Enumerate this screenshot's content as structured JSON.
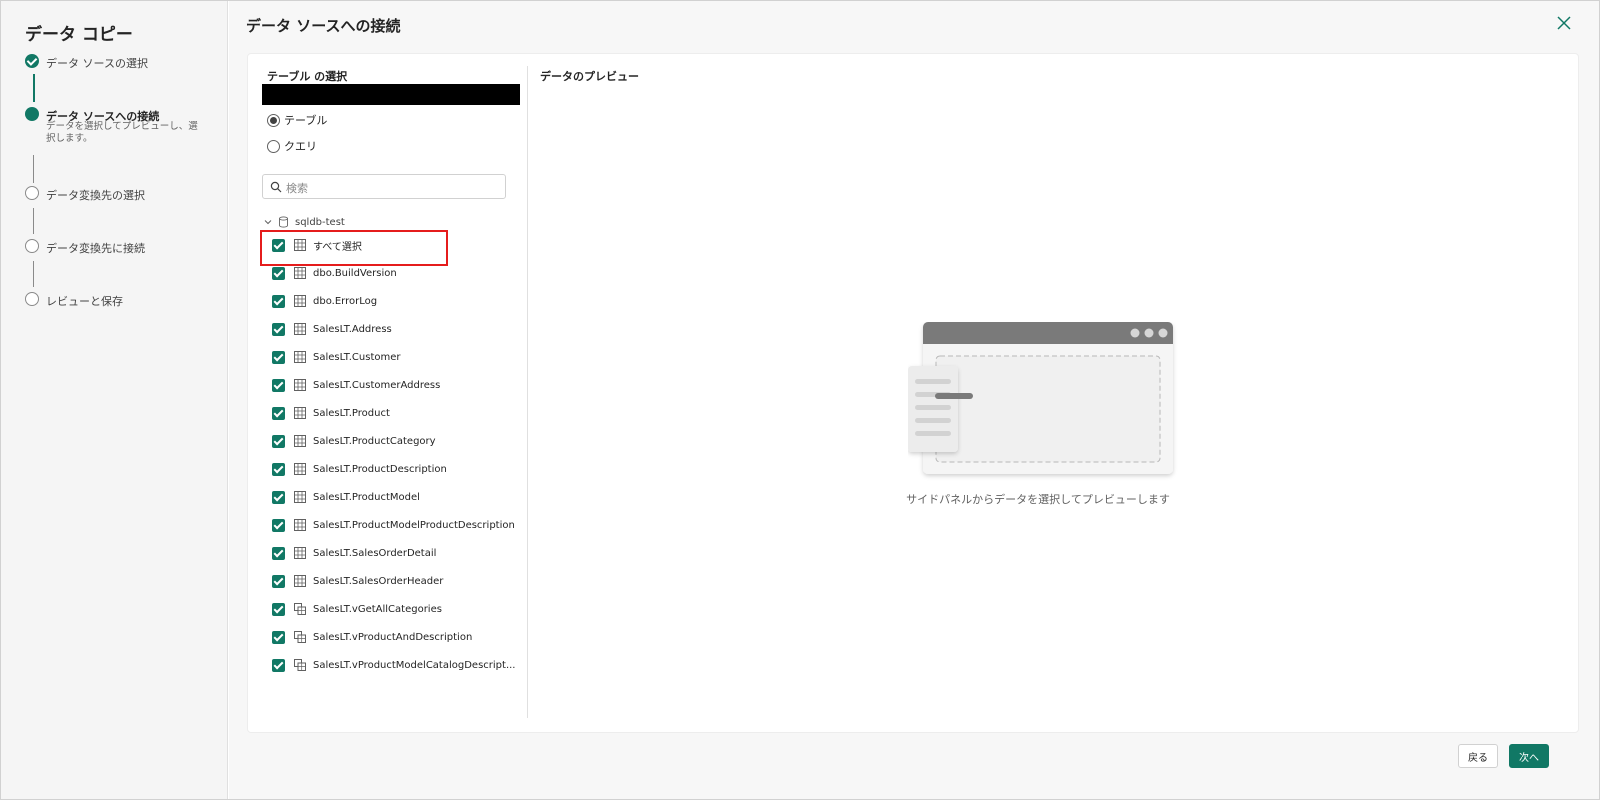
{
  "wizard": {
    "title": "データ コピー",
    "steps": [
      {
        "label": "データ ソースの選択",
        "status": "done"
      },
      {
        "label": "データ ソースへの接続",
        "status": "current",
        "description": "データを選択してプレビューし、選択します。"
      },
      {
        "label": "データ変換先の選択",
        "status": "todo"
      },
      {
        "label": "データ変換先に接続",
        "status": "todo"
      },
      {
        "label": "レビューと保存",
        "status": "todo"
      }
    ]
  },
  "main": {
    "title": "データ ソースへの接続",
    "left_pane": {
      "title": "テーブル の選択",
      "radio_options": [
        {
          "label": "テーブル",
          "selected": true
        },
        {
          "label": "クエリ",
          "selected": false
        }
      ],
      "search_placeholder": "検索",
      "tree_root": "sqldb-test",
      "items": [
        {
          "label": "すべて選択",
          "icon": "table-icon",
          "checked": true
        },
        {
          "label": "dbo.BuildVersion",
          "icon": "table-icon",
          "checked": true
        },
        {
          "label": "dbo.ErrorLog",
          "icon": "table-icon",
          "checked": true
        },
        {
          "label": "SalesLT.Address",
          "icon": "table-icon",
          "checked": true
        },
        {
          "label": "SalesLT.Customer",
          "icon": "table-icon",
          "checked": true
        },
        {
          "label": "SalesLT.CustomerAddress",
          "icon": "table-icon",
          "checked": true
        },
        {
          "label": "SalesLT.Product",
          "icon": "table-icon",
          "checked": true
        },
        {
          "label": "SalesLT.ProductCategory",
          "icon": "table-icon",
          "checked": true
        },
        {
          "label": "SalesLT.ProductDescription",
          "icon": "table-icon",
          "checked": true
        },
        {
          "label": "SalesLT.ProductModel",
          "icon": "table-icon",
          "checked": true
        },
        {
          "label": "SalesLT.ProductModelProductDescription",
          "icon": "table-icon",
          "checked": true
        },
        {
          "label": "SalesLT.SalesOrderDetail",
          "icon": "table-icon",
          "checked": true
        },
        {
          "label": "SalesLT.SalesOrderHeader",
          "icon": "table-icon",
          "checked": true
        },
        {
          "label": "SalesLT.vGetAllCategories",
          "icon": "view-icon",
          "checked": true
        },
        {
          "label": "SalesLT.vProductAndDescription",
          "icon": "view-icon",
          "checked": true
        },
        {
          "label": "SalesLT.vProductModelCatalogDescript...",
          "icon": "view-icon",
          "checked": true
        }
      ]
    },
    "preview": {
      "title": "データのプレビュー",
      "empty_message": "サイドパネルからデータを選択してプレビューします"
    },
    "footer": {
      "back_label": "戻る",
      "next_label": "次へ"
    }
  },
  "colors": {
    "accent": "#117865",
    "highlight": "#e51c1c"
  }
}
